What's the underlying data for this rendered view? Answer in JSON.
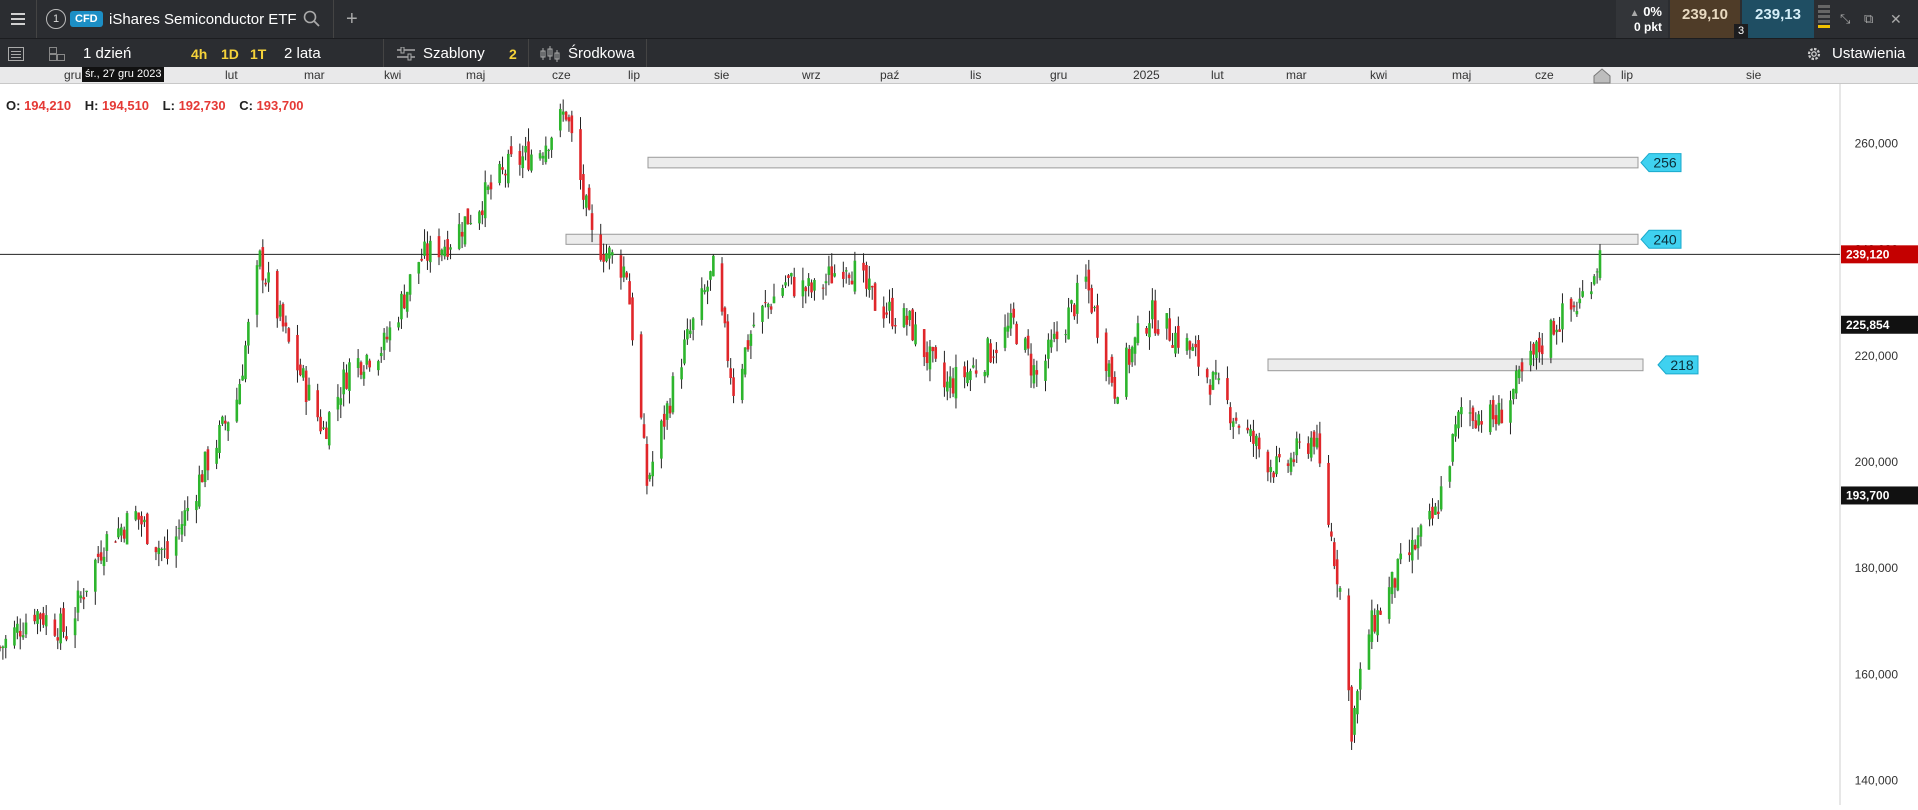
{
  "topbar": {
    "step_number": "1",
    "badge": "CFD",
    "instrument": "iShares Semiconductor ETF",
    "change_pct": "0%",
    "change_pts": "0 pkt",
    "sell_price": "239,10",
    "spread": "3",
    "buy_price": "239,13"
  },
  "toolbar": {
    "interval": "1 dzień",
    "quick_intervals": [
      "4h",
      "1D",
      "1T"
    ],
    "range": "2 lata",
    "templates_label": "Szablony",
    "templates_count": "2",
    "indicator_label": "Środkowa",
    "settings_label": "Ustawienia"
  },
  "datebar": {
    "tooltip": "śr., 27 gru 2023",
    "months": [
      "gru",
      "lut",
      "mar",
      "kwi",
      "maj",
      "cze",
      "lip",
      "sie",
      "wrz",
      "paź",
      "lis",
      "gru",
      "2025",
      "lut",
      "mar",
      "kwi",
      "maj",
      "cze",
      "lip",
      "sie"
    ]
  },
  "ohlc": {
    "o_label": "O:",
    "o_value": "194,210",
    "h_label": "H:",
    "h_value": "194,510",
    "l_label": "L:",
    "l_value": "192,730",
    "c_label": "C:",
    "c_value": "193,700"
  },
  "chart_data": {
    "type": "candlestick",
    "y_ticks": [
      "260,000",
      "240,000",
      "220,000",
      "200,000",
      "180,000",
      "160,000",
      "140,000"
    ],
    "y_tick_values": [
      260,
      240,
      220,
      200,
      180,
      160,
      140
    ],
    "ylim": [
      135.4,
      271.2
    ],
    "price_labels": {
      "current": "239,120",
      "middle": "225,854",
      "close": "193,700"
    },
    "price_levels": {
      "current": 239.12,
      "middle": 225.854,
      "close": 193.7
    },
    "zones": [
      {
        "label": "256",
        "low": 255.4,
        "high": 257.4
      },
      {
        "label": "240",
        "low": 241.0,
        "high": 242.9
      },
      {
        "label": "218",
        "low": 217.2,
        "high": 219.4
      }
    ],
    "close_path": [
      [
        "2023-12-27",
        165
      ],
      [
        "2024-01-08",
        172
      ],
      [
        "2024-01-19",
        168
      ],
      [
        "2024-02-01",
        185
      ],
      [
        "2024-02-12",
        190
      ],
      [
        "2024-02-23",
        182
      ],
      [
        "2024-03-06",
        198
      ],
      [
        "2024-03-18",
        212
      ],
      [
        "2024-03-26",
        238
      ],
      [
        "2024-04-05",
        222
      ],
      [
        "2024-04-17",
        206
      ],
      [
        "2024-04-26",
        218
      ],
      [
        "2024-05-08",
        222
      ],
      [
        "2024-05-20",
        238
      ],
      [
        "2024-05-31",
        242
      ],
      [
        "2024-06-12",
        250
      ],
      [
        "2024-06-21",
        256
      ],
      [
        "2024-07-01",
        259
      ],
      [
        "2024-07-10",
        266
      ],
      [
        "2024-07-19",
        242
      ],
      [
        "2024-07-31",
        236
      ],
      [
        "2024-08-07",
        196
      ],
      [
        "2024-08-19",
        220
      ],
      [
        "2024-08-30",
        236
      ],
      [
        "2024-09-06",
        214
      ],
      [
        "2024-09-13",
        226
      ],
      [
        "2024-09-24",
        234
      ],
      [
        "2024-10-04",
        232
      ],
      [
        "2024-10-15",
        238
      ],
      [
        "2024-10-25",
        230
      ],
      [
        "2024-11-06",
        226
      ],
      [
        "2024-11-18",
        214
      ],
      [
        "2024-11-29",
        218
      ],
      [
        "2024-12-12",
        226
      ],
      [
        "2024-12-20",
        216
      ],
      [
        "2025-01-06",
        234
      ],
      [
        "2025-01-16",
        214
      ],
      [
        "2025-01-28",
        228
      ],
      [
        "2025-02-10",
        222
      ],
      [
        "2025-02-20",
        214
      ],
      [
        "2025-03-03",
        205
      ],
      [
        "2025-03-14",
        198
      ],
      [
        "2025-03-26",
        205
      ],
      [
        "2025-04-04",
        176
      ],
      [
        "2025-04-08",
        150
      ],
      [
        "2025-04-14",
        168
      ],
      [
        "2025-04-25",
        180
      ],
      [
        "2025-05-07",
        190
      ],
      [
        "2025-05-16",
        210
      ],
      [
        "2025-05-28",
        208
      ],
      [
        "2025-06-06",
        216
      ],
      [
        "2025-06-17",
        226
      ],
      [
        "2025-06-26",
        230
      ],
      [
        "2025-07-03",
        239
      ]
    ]
  }
}
